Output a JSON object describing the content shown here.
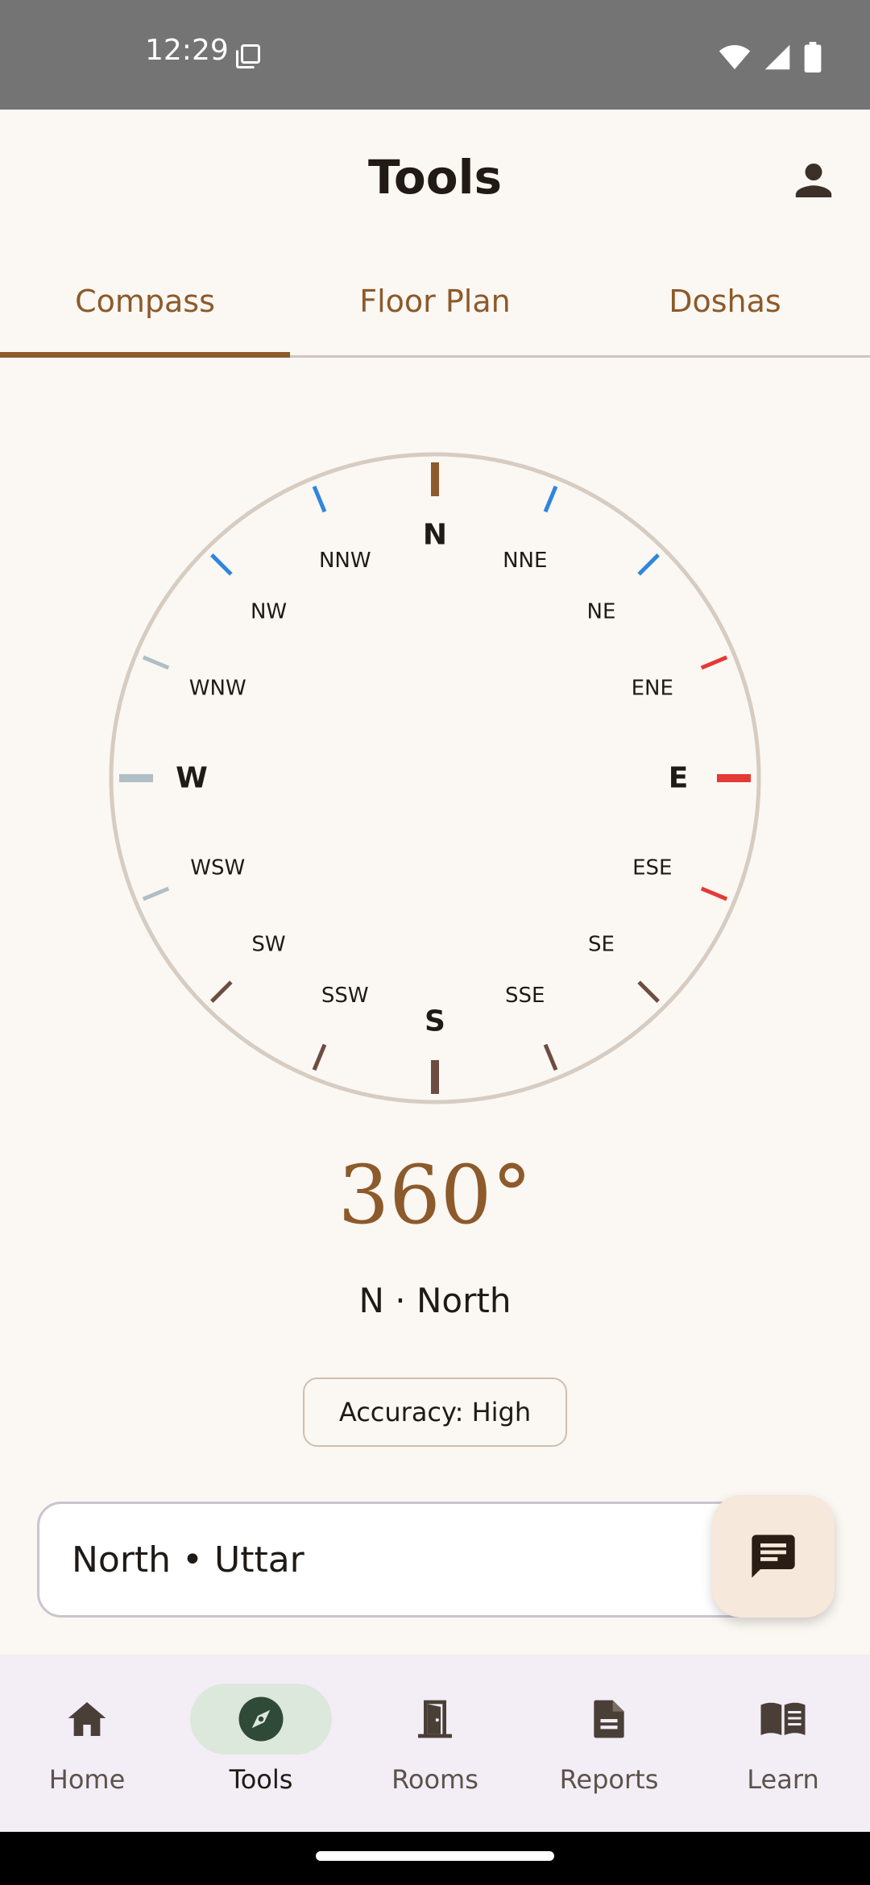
{
  "status_bar": {
    "time": "12:29"
  },
  "app_bar": {
    "title": "Tools"
  },
  "tabs": [
    {
      "label": "Compass",
      "active": true
    },
    {
      "label": "Floor Plan",
      "active": false
    },
    {
      "label": "Doshas",
      "active": false
    }
  ],
  "compass": {
    "directions": [
      "N",
      "NNE",
      "NE",
      "ENE",
      "E",
      "ESE",
      "SE",
      "SSE",
      "S",
      "SSW",
      "SW",
      "WSW",
      "W",
      "WNW",
      "NW",
      "NNW"
    ],
    "colors": {
      "north": "#8C5A2B",
      "north_sector": "#2E86DE",
      "east_sector": "#E53935",
      "south_sector": "#6D4C41",
      "west_sector": "#B0BEC5",
      "ring": "#D6CCC2"
    }
  },
  "reading": {
    "heading": "360°",
    "direction": "N · North",
    "accuracy": "Accuracy: High"
  },
  "direction_card": {
    "text": "North • Uttar"
  },
  "bottom_nav": [
    {
      "label": "Home",
      "icon": "home-icon",
      "active": false
    },
    {
      "label": "Tools",
      "icon": "compass-icon",
      "active": true
    },
    {
      "label": "Rooms",
      "icon": "door-icon",
      "active": false
    },
    {
      "label": "Reports",
      "icon": "document-icon",
      "active": false
    },
    {
      "label": "Learn",
      "icon": "book-icon",
      "active": false
    }
  ]
}
